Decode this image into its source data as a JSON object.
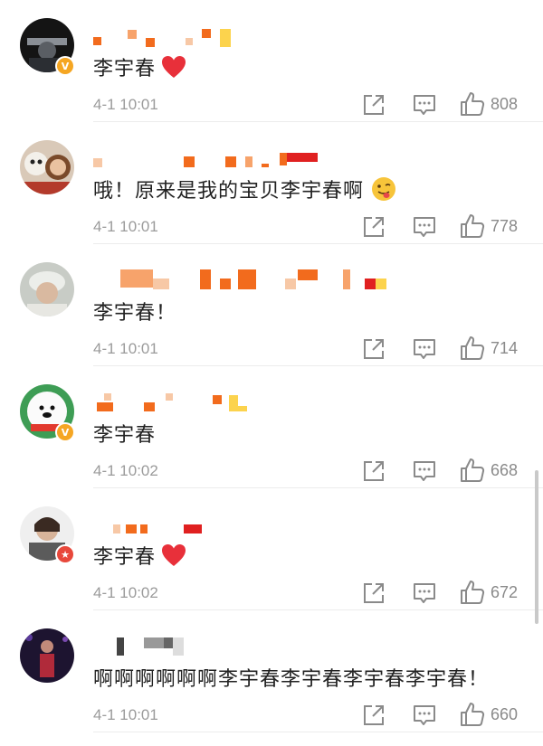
{
  "comments": [
    {
      "text": "李宇春",
      "emoji": "heart-icon",
      "time": "4-1 10:01",
      "likes": "808",
      "badge": "verified"
    },
    {
      "text": "哦！原来是我的宝贝李宇春啊",
      "emoji": "tongue-face-icon",
      "time": "4-1 10:01",
      "likes": "778",
      "badge": "none"
    },
    {
      "text": "李宇春！",
      "emoji": "",
      "time": "4-1 10:01",
      "likes": "714",
      "badge": "none"
    },
    {
      "text": "李宇春",
      "emoji": "",
      "time": "4-1 10:02",
      "likes": "668",
      "badge": "verified"
    },
    {
      "text": "李宇春",
      "emoji": "heart-icon",
      "time": "4-1 10:02",
      "likes": "672",
      "badge": "star"
    },
    {
      "text": "啊啊啊啊啊啊李宇春李宇春李宇春李宇春！",
      "emoji": "",
      "time": "4-1 10:01",
      "likes": "660",
      "badge": "none"
    }
  ],
  "icons": {
    "share": "share-icon",
    "reply": "comment-icon",
    "like": "thumbs-up-icon"
  },
  "colors": {
    "blur_orange": "#f26b1d",
    "blur_red": "#e02020",
    "blur_yellow": "#fcd34d",
    "verified_badge": "#f5a623",
    "star_badge": "#e8483b",
    "heart": "#e8303a"
  }
}
